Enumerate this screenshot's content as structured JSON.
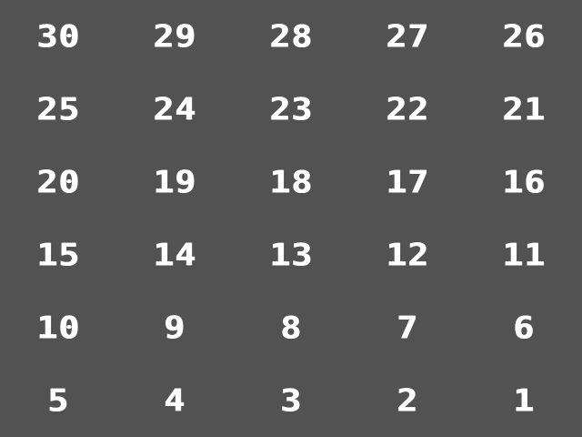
{
  "board": {
    "background_color": "#525252",
    "text_color": "#ffffff",
    "cells": [
      "30",
      "29",
      "28",
      "27",
      "26",
      "25",
      "24",
      "23",
      "22",
      "21",
      "20",
      "19",
      "18",
      "17",
      "16",
      "15",
      "14",
      "13",
      "12",
      "11",
      "10",
      "9",
      "8",
      "7",
      "6",
      "5",
      "4",
      "3",
      "2",
      "1"
    ]
  }
}
